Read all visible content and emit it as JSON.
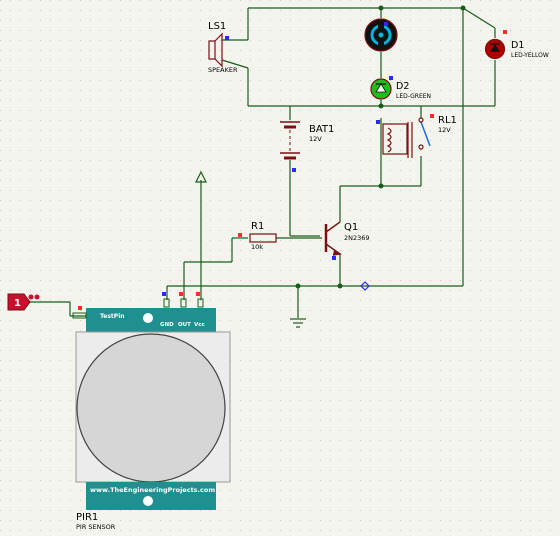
{
  "colors": {
    "background": "#f4f4ee",
    "grid_dot": "#c9c9bd",
    "wire": "#1a5c1a",
    "component": "#7a1010",
    "label": "#000000",
    "pin_blue": "#2a2aff",
    "pin_red": "#ff2a2a",
    "pir_teal": "#1f8f8f",
    "pir_body": "#d9d9d9",
    "led_green": "#1dbd1d",
    "led_red": "#b00000",
    "input_terminal": "#c8102e",
    "motor_fill": "#111111",
    "motor_ring": "#00b5d8"
  },
  "components": {
    "speaker": {
      "ref": "LS1",
      "value": "SPEAKER",
      "icon": "speaker-icon"
    },
    "motor": {
      "icon": "motor-icon"
    },
    "led_yellow": {
      "ref": "D1",
      "value": "LED-YELLOW",
      "icon": "led-icon"
    },
    "led_green": {
      "ref": "D2",
      "value": "LED-GREEN",
      "icon": "led-icon"
    },
    "battery": {
      "ref": "BAT1",
      "value": "12V",
      "icon": "battery-icon"
    },
    "relay": {
      "ref": "RL1",
      "value": "12V",
      "icon": "relay-icon"
    },
    "resistor": {
      "ref": "R1",
      "value": "10k",
      "icon": "resistor-icon"
    },
    "transistor": {
      "ref": "Q1",
      "value": "2N2369",
      "icon": "npn-transistor-icon"
    },
    "input_terminal": {
      "label": "1",
      "icon": "logic-input-icon"
    },
    "pir": {
      "ref": "PIR1",
      "value": "PIR SENSOR",
      "test_pin": "TestPin",
      "pins": [
        "GND",
        "OUT",
        "Vcc"
      ],
      "website": "www.TheEngineeringProjects.com"
    }
  }
}
